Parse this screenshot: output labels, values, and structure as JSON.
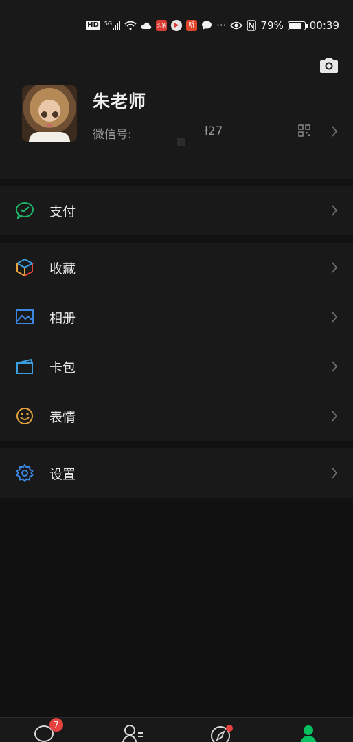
{
  "status_bar": {
    "badge": "HD",
    "network": "5G",
    "apps": [
      "头条",
      "▶",
      "听"
    ],
    "more": "···",
    "battery": "79%",
    "time": "00:39"
  },
  "profile": {
    "name": "朱老师",
    "wechat_id_label": "微信号:",
    "wechat_id_value": "ł27"
  },
  "menu": {
    "pay": {
      "label": "支付",
      "icon": "wechat-pay-icon",
      "color": "#1fb36a"
    },
    "favorites": {
      "label": "收藏",
      "icon": "cube-icon"
    },
    "album": {
      "label": "相册",
      "icon": "image-icon",
      "color": "#3b86e0"
    },
    "cards": {
      "label": "卡包",
      "icon": "wallet-icon",
      "color": "#3b9ee0"
    },
    "stickers": {
      "label": "表情",
      "icon": "smiley-icon",
      "color": "#e0a23b"
    },
    "settings": {
      "label": "设置",
      "icon": "gear-icon",
      "color": "#3b86e0"
    }
  },
  "tabbar": {
    "chats_badge": "7",
    "tabs": [
      "chats-tab",
      "contacts-tab",
      "discover-tab",
      "me-tab"
    ],
    "active_color": "#07c160"
  }
}
